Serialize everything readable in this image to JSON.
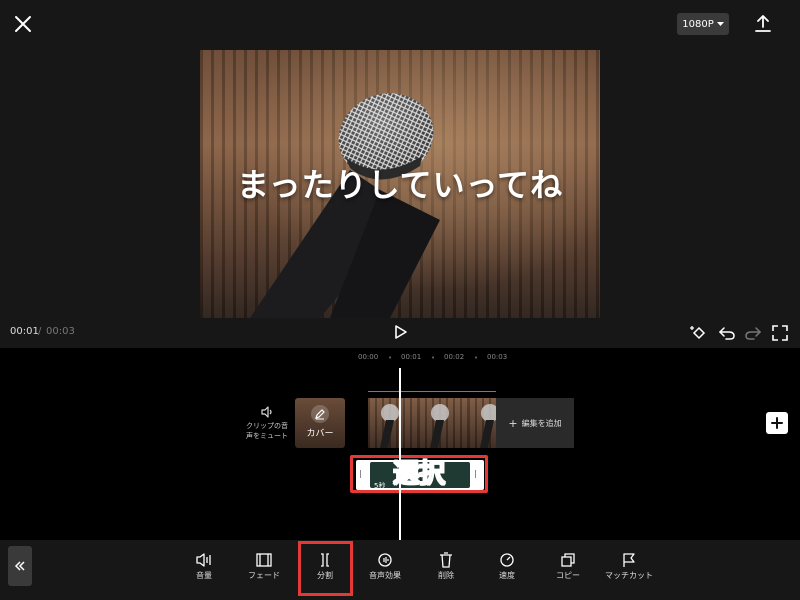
{
  "top_bar": {
    "resolution": "1080P"
  },
  "preview": {
    "caption": "まったりしていってね"
  },
  "playback": {
    "current_time": "00:01",
    "separator": "/",
    "total_time": "00:03"
  },
  "timeline": {
    "ticks": [
      "00:00",
      "00:01",
      "00:02",
      "00:03"
    ],
    "mute_label_line1": "クリップの音",
    "mute_label_line2": "声をミュート",
    "cover_label": "カバー",
    "add_edit_label": "編集を追加",
    "audio_time": "5秒",
    "select_annotation": "選択"
  },
  "toolbar": {
    "items": [
      {
        "label": "音量",
        "icon": "volume-icon"
      },
      {
        "label": "フェード",
        "icon": "fade-icon"
      },
      {
        "label": "分割",
        "icon": "split-icon"
      },
      {
        "label": "音声効果",
        "icon": "voice-effect-icon"
      },
      {
        "label": "削除",
        "icon": "delete-icon"
      },
      {
        "label": "速度",
        "icon": "speed-icon"
      },
      {
        "label": "コピー",
        "icon": "copy-icon"
      },
      {
        "label": "マッチカット",
        "icon": "match-cut-icon"
      }
    ]
  },
  "colors": {
    "background": "#171717",
    "timeline_background": "#000000",
    "annotation_red": "#e53935",
    "audio_clip": "#1f3a33"
  }
}
